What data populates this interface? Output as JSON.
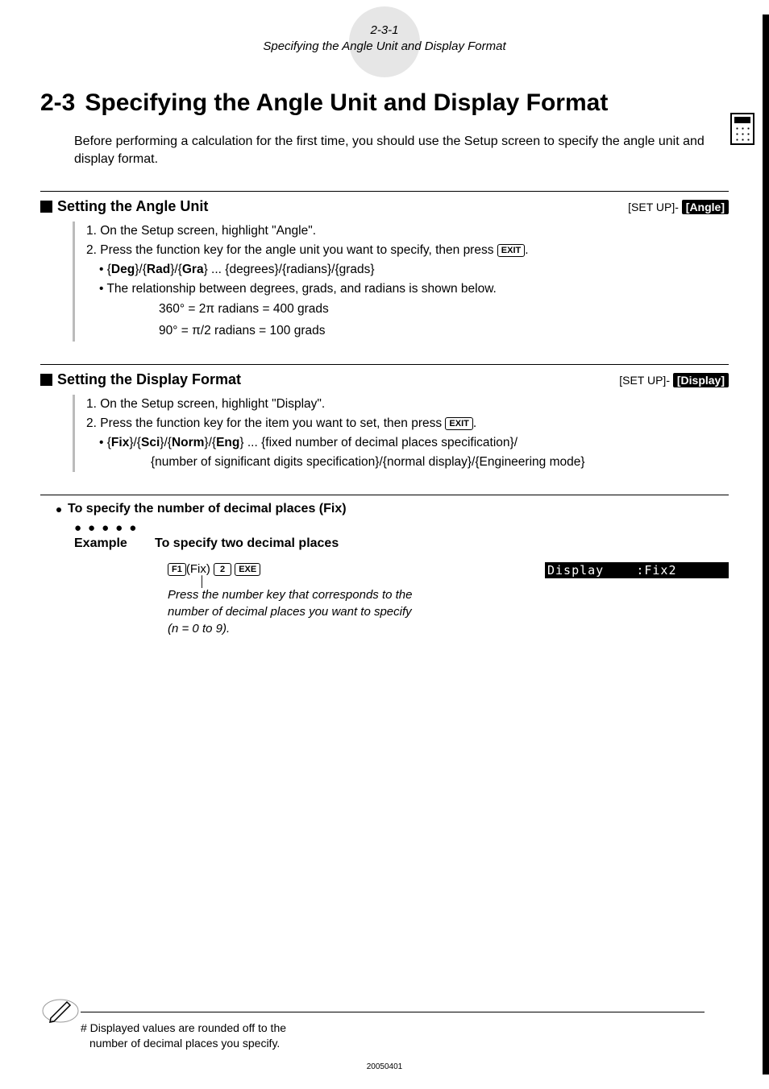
{
  "header": {
    "page_ref": "2-3-1",
    "page_title": "Specifying the Angle Unit and Display Format"
  },
  "chapter": {
    "number": "2-3",
    "title": "Specifying the Angle Unit and Display Format"
  },
  "intro": "Before performing a calculation for the first time, you should use the Setup screen to specify the angle unit and display format.",
  "section_angle": {
    "title": "Setting the Angle Unit",
    "tag_prefix": "[SET UP]",
    "tag_pill": "[Angle]",
    "step1": "1. On the Setup screen, highlight \"Angle\".",
    "step2_pre": "2. Press the function key for the angle unit you want to specify, then press ",
    "step2_key": "EXIT",
    "step2_post": ".",
    "bullet1_pre": "• {",
    "bullet1_b1": "Deg",
    "bullet1_m1": "}/{",
    "bullet1_b2": "Rad",
    "bullet1_m2": "}/{",
    "bullet1_b3": "Gra",
    "bullet1_post": "} ... {degrees}/{radians}/{grads}",
    "bullet2": "• The relationship between degrees, grads, and radians is shown below.",
    "formula1": "360° = 2π radians = 400 grads",
    "formula2": "90° = π/2 radians = 100 grads"
  },
  "section_display": {
    "title": "Setting the Display Format",
    "tag_prefix": "[SET UP]",
    "tag_pill": "[Display]",
    "step1": "1. On the Setup screen, highlight \"Display\".",
    "step2_pre": "2. Press the function key for the item you want to set, then press ",
    "step2_key": "EXIT",
    "step2_post": ".",
    "bullet_pre": "• {",
    "bullet_b1": "Fix",
    "bullet_m1": "}/{",
    "bullet_b2": "Sci",
    "bullet_m2": "}/{",
    "bullet_b3": "Norm",
    "bullet_m3": "}/{",
    "bullet_b4": "Eng",
    "bullet_post": "} ... {fixed number of decimal places specification}/",
    "bullet_line2": "{number of significant digits specification}/{normal display}/{Engineering mode}"
  },
  "fix_section": {
    "title": "To specify the number of decimal places (Fix)",
    "example_label": "Example",
    "example_text": "To specify two decimal places",
    "key_f1": "F1",
    "key_fix": "(Fix)",
    "key_2": "2",
    "key_exe": "EXE",
    "lcd_text": "Display    :Fix2",
    "note_line1": "Press the number key that corresponds to the",
    "note_line2": "number of decimal places you want to specify",
    "note_line3": "(n = 0 to 9)."
  },
  "footnote": {
    "line1": "# Displayed values are rounded off to the",
    "line2": "number of decimal places you specify."
  },
  "date_code": "20050401"
}
